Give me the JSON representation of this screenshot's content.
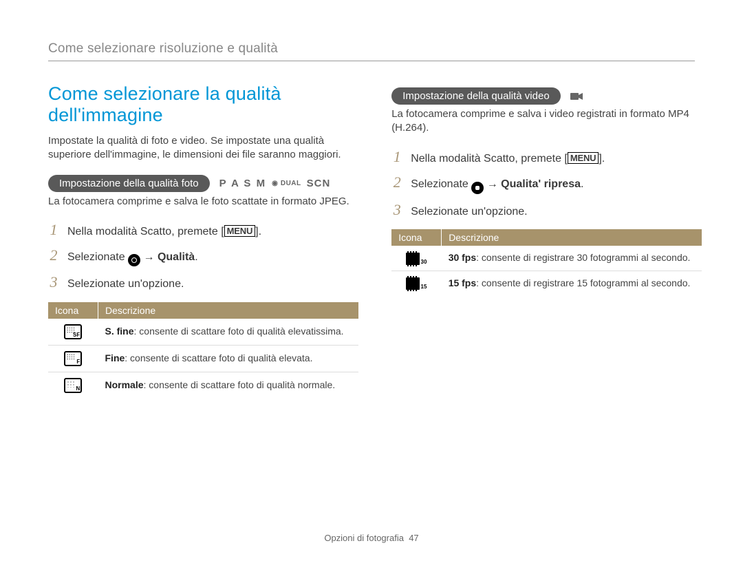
{
  "breadcrumb": "Come selezionare risoluzione e qualità",
  "h1": "Come selezionare la qualità dell'immagine",
  "lead": "Impostate la qualità di foto e video. Se impostate una qualità superiore dell'immagine, le dimensioni dei file saranno maggiori.",
  "foto": {
    "pill": "Impostazione della qualità foto",
    "modes": {
      "letters": "P A S M",
      "dual": "DUAL",
      "scn": "SCN"
    },
    "sub": "La fotocamera comprime e salva le foto scattate in formato JPEG.",
    "steps": [
      {
        "pre": "Nella modalità Scatto, premete [",
        "menu": "MENU",
        "post": "]."
      },
      {
        "pre": "Selezionate ",
        "icon": "camera",
        "arrow": " → ",
        "bold": "Qualità",
        "post": "."
      },
      {
        "pre": "Selezionate un'opzione."
      }
    ],
    "table_head_icon": "Icona",
    "table_head_desc": "Descrizione",
    "rows": [
      {
        "sub": "SF",
        "bold": "S. fine",
        "desc": ": consente di scattare foto di qualità elevatissima."
      },
      {
        "sub": "F",
        "bold": "Fine",
        "desc": ": consente di scattare foto di qualità elevata."
      },
      {
        "sub": "N",
        "bold": "Normale",
        "desc": ": consente di scattare foto di qualità normale."
      }
    ]
  },
  "video": {
    "pill": "Impostazione della qualità video",
    "sub": "La fotocamera comprime e salva i video registrati in formato MP4 (H.264).",
    "steps": [
      {
        "pre": "Nella modalità Scatto, premete [",
        "menu": "MENU",
        "post": "]."
      },
      {
        "pre": "Selezionate ",
        "icon": "video",
        "arrow": " → ",
        "bold": "Qualita' ripresa",
        "post": "."
      },
      {
        "pre": "Selezionate un'opzione."
      }
    ],
    "table_head_icon": "Icona",
    "table_head_desc": "Descrizione",
    "rows": [
      {
        "num": "30",
        "bold": "30 fps",
        "desc": ": consente di registrare 30 fotogrammi al secondo."
      },
      {
        "num": "15",
        "bold": "15 fps",
        "desc": ": consente di registrare 15 fotogrammi al secondo."
      }
    ]
  },
  "footer": {
    "label": "Opzioni di fotografia",
    "page": "47"
  }
}
